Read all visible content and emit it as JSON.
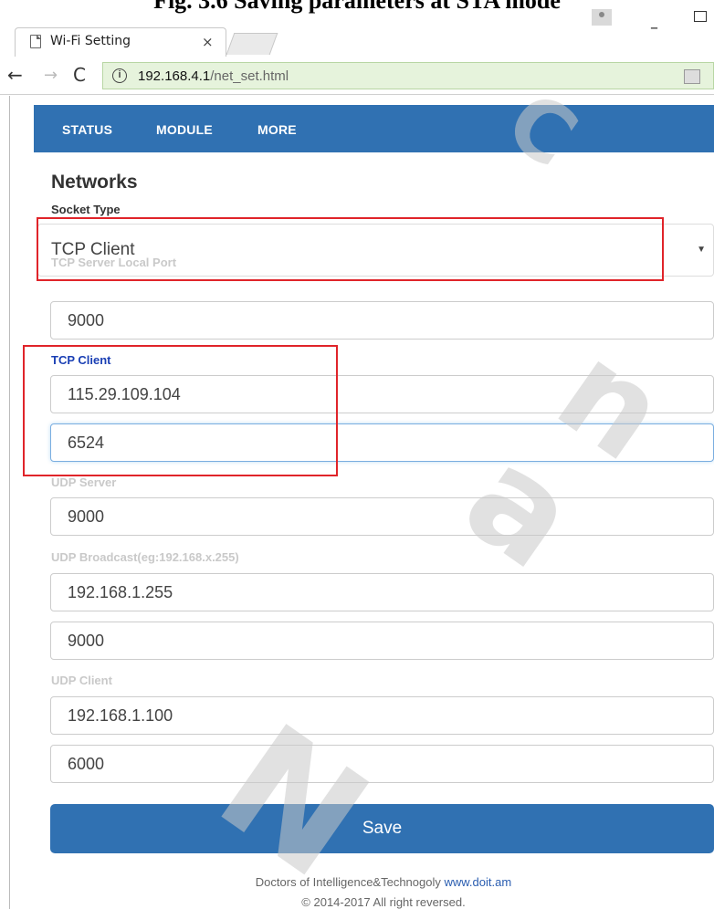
{
  "caption": "Fig. 3.6 Saving parameters at STA mode",
  "browser": {
    "tab_title": "Wi-Fi Setting",
    "tab_close": "×",
    "url_host": "192.168.4.1",
    "url_path": "/net_set.html"
  },
  "nav": {
    "items": [
      "STATUS",
      "MODULE",
      "MORE"
    ]
  },
  "form": {
    "heading": "Networks",
    "socket_type_label": "Socket Type",
    "socket_type_value": "TCP Client",
    "tcp_server_label": "TCP Server Local Port",
    "tcp_server_port": "9000",
    "tcp_client_label": "TCP Client",
    "tcp_client_ip": "115.29.109.104",
    "tcp_client_port": "6524",
    "udp_server_label": "UDP Server",
    "udp_server_port": "9000",
    "udp_broadcast_label": "UDP Broadcast(eg:192.168.x.255)",
    "udp_broadcast_ip": "192.168.1.255",
    "udp_broadcast_port": "9000",
    "udp_client_label": "UDP Client",
    "udp_client_ip": "192.168.1.100",
    "udp_client_port": "6000",
    "save_label": "Save"
  },
  "footer": {
    "company": "Doctors of Intelligence&Technogoly",
    "link": "www.doit.am",
    "copyright": "© 2014-2017 All right reversed."
  },
  "colors": {
    "nav_bg": "#3071b2",
    "highlight": "#e0242a",
    "tcp_client_label": "#1a3fb4"
  }
}
